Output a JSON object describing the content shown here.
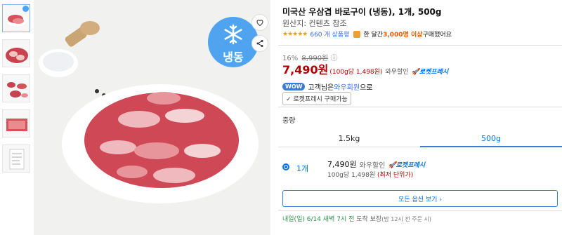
{
  "thumbnails": [
    {
      "name": "thumb-1",
      "selected": true
    },
    {
      "name": "thumb-2",
      "selected": false
    },
    {
      "name": "thumb-3",
      "selected": false
    },
    {
      "name": "thumb-4",
      "selected": false
    },
    {
      "name": "thumb-5",
      "selected": false
    }
  ],
  "main_image": {
    "badge_label": "냉동"
  },
  "product": {
    "title": "미국산 우삼겹 바로구이 (냉동), 1개, 500g",
    "origin": "원산지: 컨텐츠 참조",
    "stars": "★★★★★",
    "review_count": "660 개 상품평",
    "purchase_pre": "한 달간 ",
    "purchase_count": "3,000명 이상",
    "purchase_post": " 구매했어요"
  },
  "pricing": {
    "discount_rate": "16%",
    "original_price": "8,990원",
    "info_icon": "ⓘ",
    "sale_price": "7,490원",
    "unit_price": "(100g당 1,498원)",
    "wow_label": "와우할인",
    "rocket_label": "로켓프레시"
  },
  "wow": {
    "badge": "WOW",
    "text_pre": "고객님은 ",
    "link": "와우회원",
    "text_post": "으로"
  },
  "chip": {
    "label": "✓ 로켓프레시 구매가능"
  },
  "options": {
    "label": "중량",
    "tabs": [
      {
        "label": "1.5kg",
        "active": false
      },
      {
        "label": "500g",
        "active": true
      }
    ],
    "selected": {
      "qty": "1개",
      "price": "7,490원",
      "wow": "와우할인",
      "rocket": "로켓프레시",
      "unit": "100g당 1,498원",
      "lowest": "(최저 단위가)"
    },
    "all_options": "모든 옵션 보기 ›"
  },
  "delivery": {
    "text": "내일(일) 6/14 새벽 7시 전",
    "suffix": " 도착 보장",
    "note": "(밤 12시 전 주문 시)"
  },
  "colors": {
    "price": "#ae0000",
    "link": "#0073e9",
    "accent": "#3a7bd5",
    "badge_bg": "#4fa3ef"
  }
}
